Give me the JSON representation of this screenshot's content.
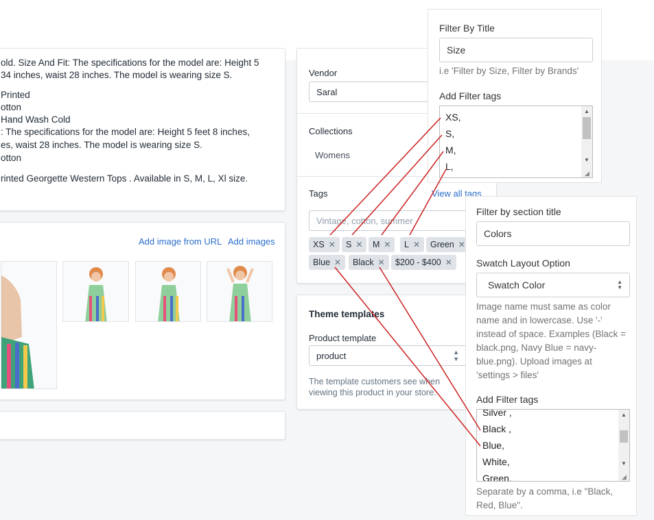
{
  "description": {
    "lines": [
      "old. Size And Fit: The specifications for the model are: Height 5",
      " 34 inches, waist 28 inches. The model is wearing size S.",
      "Printed",
      "otton",
      "Hand Wash Cold",
      ": The specifications for the model are: Height 5 feet 8 inches,",
      "es, waist 28 inches. The model is wearing size S.",
      "otton",
      "rinted Georgette Western Tops . Available in S, M, L, Xl size."
    ]
  },
  "media": {
    "add_from_url": "Add image from URL",
    "add_images": "Add images"
  },
  "organization": {
    "vendor_label": "Vendor",
    "vendor_value": "Saral",
    "collections_label": "Collections",
    "collection_value": "Womens",
    "tags_label": "Tags",
    "view_all_tags": "View all tags",
    "tags_placeholder": "Vintage, cotton, summer",
    "tags": [
      "XS",
      "S",
      "M",
      "L",
      "Green",
      "Blue",
      "Black",
      "$200 - $400"
    ]
  },
  "theme": {
    "title": "Theme templates",
    "product_template_label": "Product template",
    "product_template_value": "product",
    "help": [
      "The template customers see when",
      "viewing this product in your store."
    ]
  },
  "popup_size": {
    "filter_title_label": "Filter By Title",
    "filter_title_value": "Size",
    "filter_title_help": "i.e 'Filter by Size, Filter by Brands'",
    "tags_label": "Add Filter tags",
    "tags_lines": [
      "XS,",
      "S,",
      "M,",
      "L,"
    ]
  },
  "popup_color": {
    "section_title_label": "Filter by section title",
    "section_title_value": "Colors",
    "swatch_label": "Swatch Layout Option",
    "swatch_value": "Swatch Color",
    "swatch_help": [
      "Image name must same as color",
      "name and in lowercase. Use '-'",
      "instead of space. Examples (Black =",
      "black.png, Navy Blue = navy-",
      "blue.png). Upload images at",
      "'settings > files'"
    ],
    "tags_label": "Add Filter tags",
    "tags_lines": [
      "Silver ,",
      "Black ,",
      "Blue,",
      "White,",
      "Green,"
    ],
    "separator_help": [
      "Separate by a comma, i.e \"Black,",
      "Red, Blue\"."
    ]
  },
  "colors": {
    "accent_link": "#2c6ecb",
    "connector_line": "#cc1f1f",
    "tag_bg": "#dfe3e8"
  }
}
